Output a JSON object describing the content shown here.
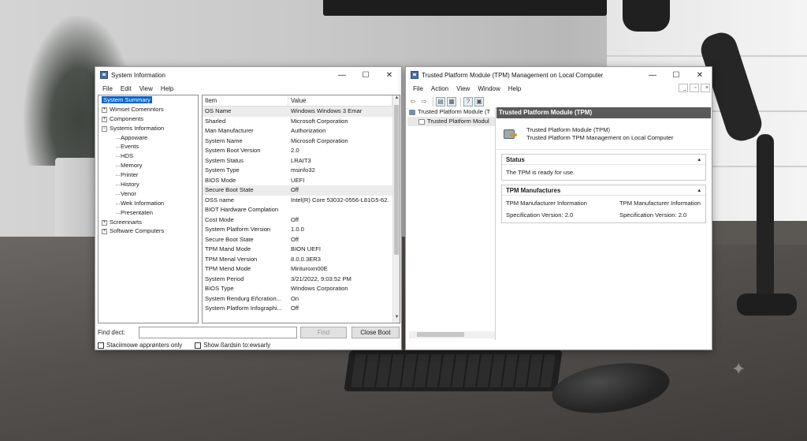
{
  "sysinfo": {
    "title": "System Information",
    "controls": {
      "minimize": "—",
      "maximize": "☐",
      "close": "✕"
    },
    "menu": [
      "File",
      "Edit",
      "View",
      "Help"
    ],
    "tree": [
      {
        "label": "System Summary",
        "level": 0,
        "selected": true
      },
      {
        "label": "Wimset Comenntors",
        "level": 0,
        "expander": "+"
      },
      {
        "label": "Components",
        "level": 0,
        "expander": "+"
      },
      {
        "label": "Systems Information",
        "level": 0,
        "expander": "−"
      },
      {
        "label": "Appoware",
        "level": 1
      },
      {
        "label": "Events",
        "level": 1
      },
      {
        "label": "HDS",
        "level": 1
      },
      {
        "label": "Memory",
        "level": 1
      },
      {
        "label": "Printer",
        "level": 1
      },
      {
        "label": "History",
        "level": 1
      },
      {
        "label": "Venor",
        "level": 1
      },
      {
        "label": "Wek Information",
        "level": 1
      },
      {
        "label": "Presentaten",
        "level": 1
      },
      {
        "label": "Screennarts",
        "level": 0,
        "expander": "+"
      },
      {
        "label": "Software Computers",
        "level": 0,
        "expander": "+"
      }
    ],
    "columns": {
      "item": "Item",
      "value": "Value"
    },
    "rows": [
      {
        "item": "OS Name",
        "value": "Windows Windows 3 Emar"
      },
      {
        "item": "Sharled",
        "value": "Microsoft Corporation"
      },
      {
        "item": "Man Manufacturer",
        "value": "Authorization"
      },
      {
        "item": "System Name",
        "value": "Microsoft Corporation"
      },
      {
        "item": "System Boot Version",
        "value": "2.0"
      },
      {
        "item": "System Status",
        "value": "LRAIT3"
      },
      {
        "item": "System Type",
        "value": "msinfo32"
      },
      {
        "item": "BIOS Mode",
        "value": "UEFI"
      },
      {
        "item": "Secure Boot State",
        "value": "Off"
      },
      {
        "item": "OSS name",
        "value": "Intel(R) Core 53032-0556-L81G5-62."
      },
      {
        "item": "BIOT Hardware Complation",
        "value": ""
      },
      {
        "item": "Cost Mode",
        "value": "Off"
      },
      {
        "item": "System Platform Version",
        "value": "1.0.0"
      },
      {
        "item": "Secure Boot State",
        "value": "Off"
      },
      {
        "item": "TPM Mand Mode",
        "value": "BION UEFI"
      },
      {
        "item": "TPM Menal Version",
        "value": "8.0.0.3ER3"
      },
      {
        "item": "TPM Mend Mode",
        "value": "Mirituroxn00E"
      },
      {
        "item": "System Period",
        "value": "3/21/2022, 9:03:52 PM"
      },
      {
        "item": "BIOS Type",
        "value": "Windows Corporation"
      },
      {
        "item": "System Rendurg Eñcration...",
        "value": "On"
      },
      {
        "item": "System Platform Infographi...",
        "value": "Off"
      }
    ],
    "find_label": "Find ďect:",
    "find_value": "",
    "find_button": "Find",
    "close_button": "Close Boot",
    "check1": "Staciimowe apprønters only",
    "check2": "Show ßardsin to:ewsarly"
  },
  "tpm": {
    "title": "Trusted Platform Module (TPM) Management on Local Computer",
    "controls": {
      "minimize": "—",
      "maximize": "☐",
      "close": "✕"
    },
    "mdi_controls": {
      "minimize": "_",
      "maximize": "▫",
      "close": "×"
    },
    "menu": [
      "File",
      "Action",
      "View",
      "Window",
      "Help"
    ],
    "toolbar_icons": [
      "back-arrow-icon",
      "forward-arrow-icon",
      "console-tree-icon",
      "export-list-icon",
      "help-icon",
      "properties-icon"
    ],
    "scope": [
      {
        "label": "Trusted Platform Module (T",
        "child": false
      },
      {
        "label": "Trusted Platform Modul",
        "child": true
      }
    ],
    "header": "Trusted Platform Module (TPM)",
    "id_line1": "Trusted Platform Module (TPM)",
    "id_line2": "Trusted Platform TPM Management on Local Computer",
    "status_title": "Status",
    "status_text": "The TPM is ready for use.",
    "mfr_title": "TPM Manufactures",
    "mfr_cells": [
      "TPM Manufacturer Information",
      "TPM Manufacturer Information",
      "Specification Version: 2.0",
      "Specification Version: 2.0"
    ],
    "caret": "▴"
  },
  "colors": {
    "selection": "#0a64c9",
    "content_header": "#5a5a5a"
  }
}
